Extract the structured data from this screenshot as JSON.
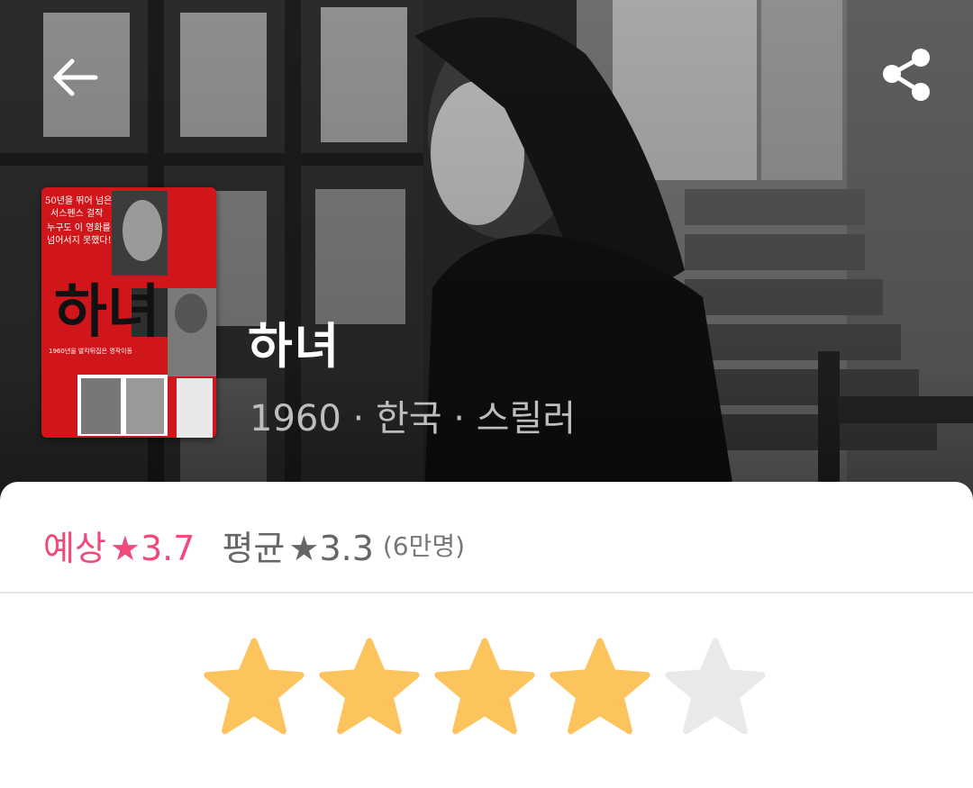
{
  "movie": {
    "title": "하녀",
    "meta": "1960 · 한국 · 스릴러"
  },
  "poster": {
    "title_text": "하녀",
    "tagline_1": "50년을 뛰어 넘은",
    "tagline_2": "서스펜스 걸작",
    "tagline_3": "누구도 이 영화를",
    "tagline_4": "넘어서지 못했다!",
    "subtitle": "1960년을 발칵뒤집은 명작이동"
  },
  "icons": {
    "back": "arrow-left-icon",
    "share": "share-icon"
  },
  "ratings": {
    "expected_label": "예상",
    "expected_value": "3.7",
    "average_label": "평균",
    "average_value": "3.3",
    "count": "(6만명)",
    "star_glyph": "★"
  },
  "user_rating": {
    "filled_stars": 4,
    "max_stars": 5
  },
  "colors": {
    "accent": "#f0497a",
    "star_filled": "#fcc45c",
    "star_empty": "#e8e9eb",
    "poster_red": "#d0161b"
  }
}
